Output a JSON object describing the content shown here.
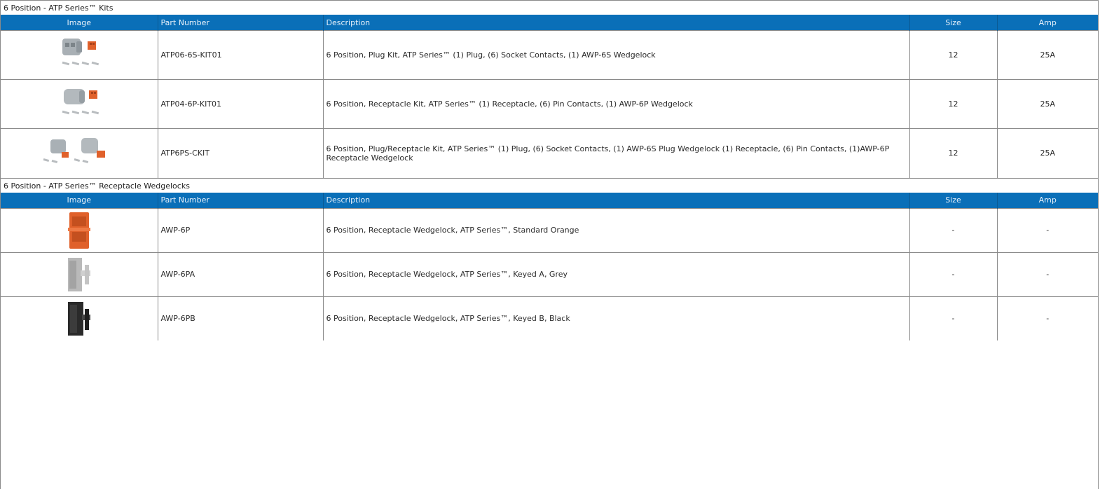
{
  "headers": {
    "image": "Image",
    "part_number": "Part Number",
    "description": "Description",
    "size": "Size",
    "amp": "Amp"
  },
  "sections": [
    {
      "title": "6 Position - ATP Series™ Kits",
      "rows": [
        {
          "image": "plug-kit-image",
          "part_number": "ATP06-6S-KIT01",
          "description": "6 Position, Plug Kit, ATP Series™ (1) Plug, (6) Socket Contacts, (1) AWP-6S Wedgelock",
          "size": "12",
          "amp": "25A"
        },
        {
          "image": "receptacle-kit-image",
          "part_number": "ATP04-6P-KIT01",
          "description": "6 Position, Receptacle Kit, ATP Series™ (1) Receptacle, (6) Pin Contacts, (1) AWP-6P Wedgelock",
          "size": "12",
          "amp": "25A"
        },
        {
          "image": "plug-receptacle-kit-image",
          "part_number": "ATP6PS-CKIT",
          "description": "6 Position, Plug/Receptacle Kit, ATP Series™ (1) Plug, (6) Socket Contacts, (1) AWP-6S Plug Wedgelock (1) Receptacle, (6) Pin Contacts, (1)AWP-6P Receptacle Wedgelock",
          "size": "12",
          "amp": "25A"
        }
      ]
    },
    {
      "title": "6 Position - ATP Series™ Receptacle Wedgelocks",
      "rows": [
        {
          "image": "orange-wedgelock-image",
          "part_number": "AWP-6P",
          "description": "6 Position, Receptacle Wedgelock, ATP Series™, Standard Orange",
          "size": "-",
          "amp": "-"
        },
        {
          "image": "grey-wedgelock-image",
          "part_number": "AWP-6PA",
          "description": "6 Position, Receptacle Wedgelock, ATP Series™, Keyed A, Grey",
          "size": "-",
          "amp": "-"
        },
        {
          "image": "black-wedgelock-image",
          "part_number": "AWP-6PB",
          "description": "6 Position, Receptacle Wedgelock, ATP Series™, Keyed B, Black",
          "size": "-",
          "amp": "-"
        }
      ]
    }
  ],
  "colors": {
    "header_bg": "#0a6fb8",
    "border": "#8a8a8a",
    "wedge_orange": "#e0612b",
    "wedge_grey": "#b9b9b9",
    "wedge_black": "#2a2a2a"
  }
}
